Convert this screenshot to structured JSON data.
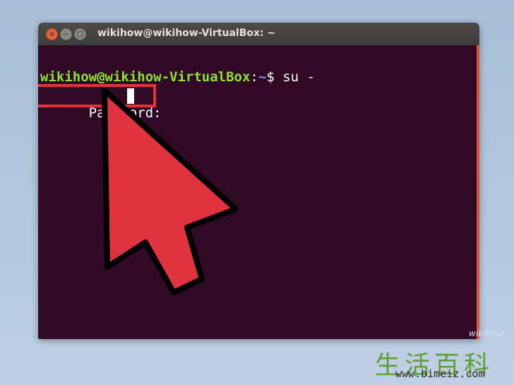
{
  "window": {
    "title": "wikihow@wikihow-VirtualBox: ~",
    "buttons": {
      "close": "×",
      "minimize": "−",
      "maximize": "□"
    }
  },
  "terminal": {
    "prompt_user_host": "wikihow@wikihow-VirtualBox",
    "prompt_colon": ":",
    "prompt_path": "~",
    "prompt_symbol": "$ ",
    "command": "su -",
    "password_prompt": "Password: "
  },
  "watermark": {
    "hanzi": "生活百科",
    "url": "www.bimeiz.com",
    "faint": "wikiHow"
  },
  "colors": {
    "terminal_bg": "#300a24",
    "prompt_user": "#8ae234",
    "prompt_path": "#729fcf",
    "highlight": "#e3323c"
  }
}
